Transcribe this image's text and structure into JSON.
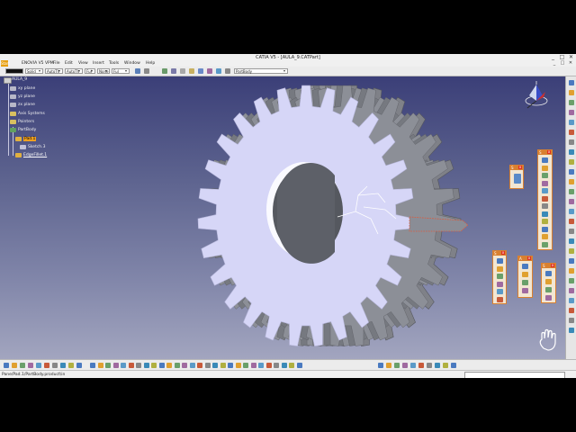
{
  "window": {
    "title": "CATIA V5 - [AULA_9.CATPart]",
    "min_label": "_",
    "max_label": "□",
    "close_label": "✕"
  },
  "menu": {
    "app_icon": "Start",
    "items": [
      "Start",
      "ENOVIA V5 VPM",
      "File",
      "Edit",
      "View",
      "Insert",
      "Tools",
      "Window",
      "Help"
    ],
    "mdi_controls": [
      "_",
      "□",
      "✕"
    ]
  },
  "toolbar": {
    "color_combo": "",
    "linetype_combo": "Solid",
    "thickness_combo": "AutoTh",
    "layer_combo": "AutoTh",
    "pattern_combo": "Ful",
    "none_combo": "None",
    "part_body_combo": "PartBody"
  },
  "tree": {
    "root": "AULA_9",
    "xy_plane": "xy plane",
    "yz_plane": "yz plane",
    "zx_plane": "zx plane",
    "axis_systems": "Axis Systems",
    "points": "Pointers",
    "part_body": "PartBody",
    "pad": "Pad.1",
    "sketch": "Sketch.3",
    "edge_fillet": "EdgeFillet.1"
  },
  "panels": {
    "p1": "S",
    "p2": "S",
    "p3": "S",
    "p4": "A",
    "p5": "S"
  },
  "status": {
    "text": "Pane/Pad.1/PartBody.product\\in"
  },
  "icons": {
    "compass": "compass-icon",
    "hand": "hand-icon"
  },
  "colors": {
    "gear_face": "#d6d6f7",
    "gear_side": "#7f8188",
    "viewport_top": "#3b3f78",
    "highlight": "#f0a020"
  }
}
